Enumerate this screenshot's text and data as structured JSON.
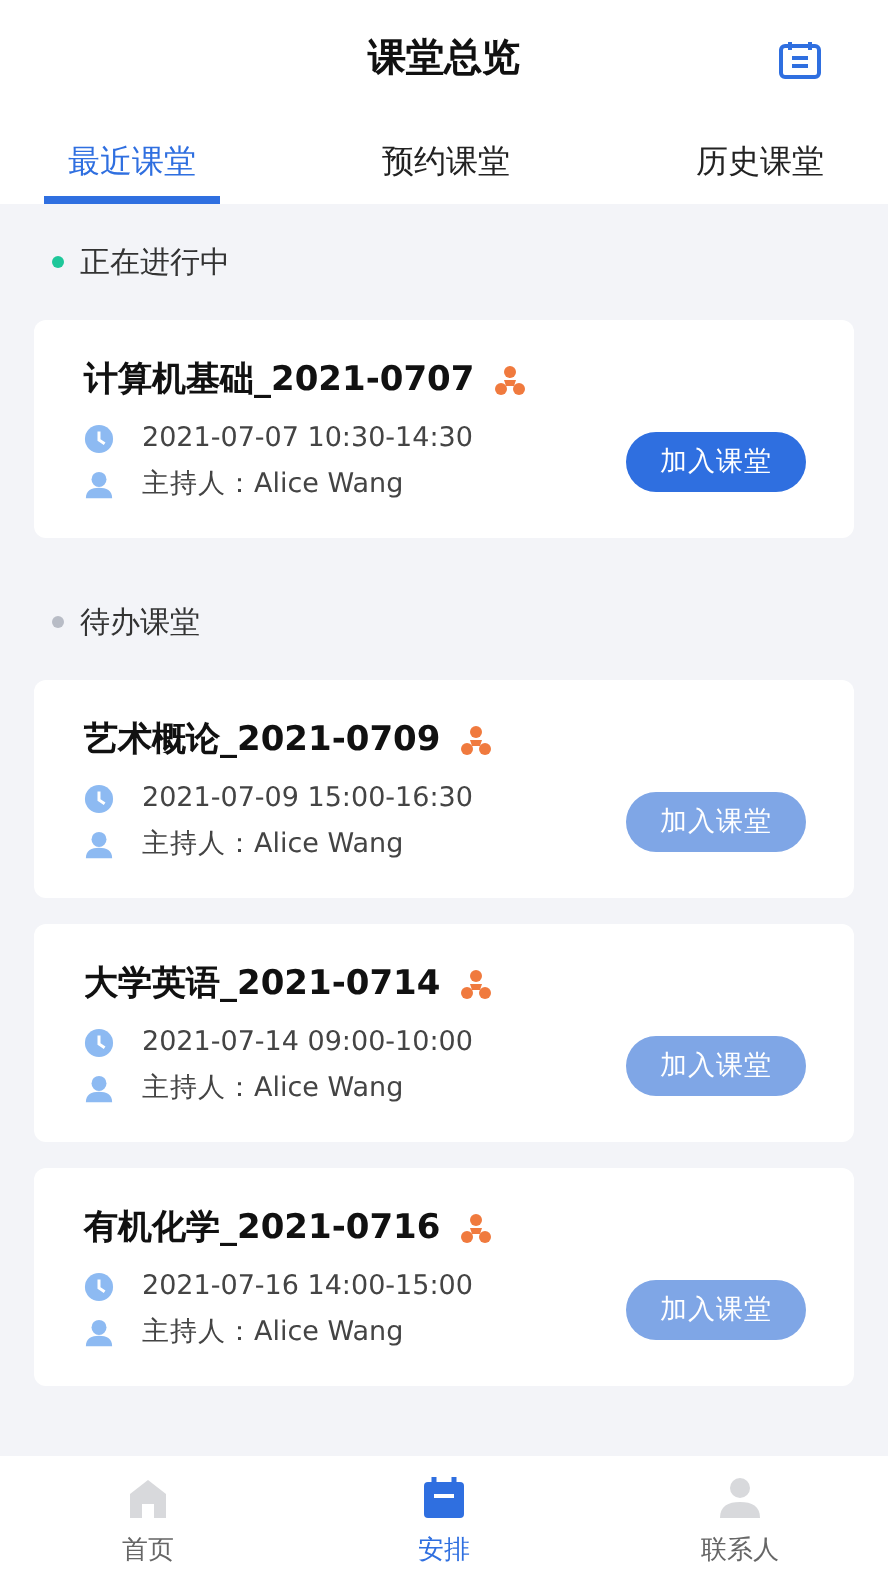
{
  "header": {
    "title": "课堂总览"
  },
  "tabs": [
    {
      "label": "最近课堂",
      "selected": true
    },
    {
      "label": "预约课堂",
      "selected": false
    },
    {
      "label": "历史课堂",
      "selected": false
    }
  ],
  "sections": [
    {
      "label": "正在进行中",
      "color": "#1ec79a",
      "cards": [
        {
          "title": "计算机基础_2021-0707",
          "time": "2021-07-07 10:30-14:30",
          "host": "主持人：Alice Wang",
          "button": {
            "label": "加入课堂",
            "disabled": false
          }
        }
      ]
    },
    {
      "label": "待办课堂",
      "color": "#b8bcc6",
      "cards": [
        {
          "title": "艺术概论_2021-0709",
          "time": "2021-07-09 15:00-16:30",
          "host": "主持人：Alice Wang",
          "button": {
            "label": "加入课堂",
            "disabled": true
          }
        },
        {
          "title": "大学英语_2021-0714",
          "time": "2021-07-14 09:00-10:00",
          "host": "主持人：Alice Wang",
          "button": {
            "label": "加入课堂",
            "disabled": true
          }
        },
        {
          "title": "有机化学_2021-0716",
          "time": "2021-07-16 14:00-15:00",
          "host": "主持人：Alice Wang",
          "button": {
            "label": "加入课堂",
            "disabled": true
          }
        }
      ]
    }
  ],
  "nav": [
    {
      "kind": "home",
      "label": "首页",
      "selected": false
    },
    {
      "kind": "calendar",
      "label": "安排",
      "selected": true
    },
    {
      "kind": "person",
      "label": "联系人",
      "selected": false
    }
  ]
}
